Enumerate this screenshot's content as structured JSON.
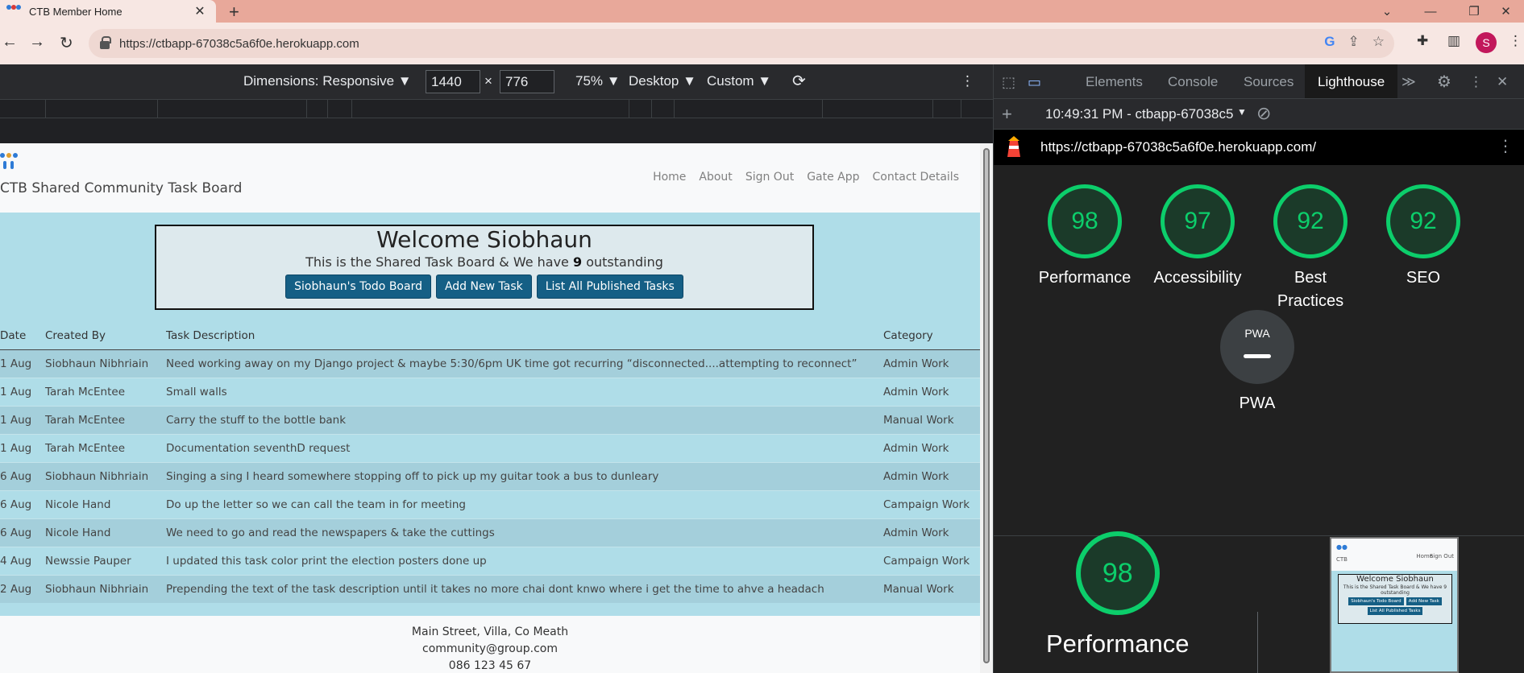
{
  "browser": {
    "tab_title": "CTB Member Home",
    "tab_close": "✕",
    "new_tab": "+",
    "url": "https://ctbapp-67038c5a6f0e.herokuapp.com",
    "profile_initial": "S",
    "win_minimize": "—",
    "win_restore": "❐",
    "win_close": "✕",
    "win_menu": "⌄"
  },
  "device_toolbar": {
    "dimensions_label": "Dimensions: Responsive ▼",
    "width": "1440",
    "times": "×",
    "height": "776",
    "zoom": "75% ▼",
    "device_type": "Desktop ▼",
    "throttle": "Custom ▼"
  },
  "site": {
    "brand": "CTB Shared Community Task Board",
    "nav": [
      "Home",
      "About",
      "Sign Out",
      "Gate App",
      "Contact Details"
    ],
    "welcome_title": "Welcome Siobhaun",
    "welcome_sub_before": "This is the Shared Task Board & We have ",
    "outstanding_count": "9",
    "welcome_sub_after": " outstanding",
    "buttons": [
      "Siobhaun's Todo Board",
      "Add New Task",
      "List All Published Tasks"
    ],
    "table": {
      "headers": [
        "Date",
        "Created By",
        "Task Description",
        "Category"
      ],
      "rows": [
        [
          "1 Aug",
          "Siobhaun Nibhriain",
          "Need working away on my Django project & maybe 5:30/6pm UK time got recurring “disconnected....attempting to reconnect”",
          "Admin Work"
        ],
        [
          "1 Aug",
          "Tarah McEntee",
          "Small walls",
          "Admin Work"
        ],
        [
          "1 Aug",
          "Tarah McEntee",
          "Carry the stuff to the bottle bank",
          "Manual Work"
        ],
        [
          "1 Aug",
          "Tarah McEntee",
          "Documentation seventhD request",
          "Admin Work"
        ],
        [
          "6 Aug",
          "Siobhaun Nibhriain",
          "Singing a sing I heard somewhere stopping off to pick up my guitar took a bus to dunleary",
          "Admin Work"
        ],
        [
          "6 Aug",
          "Nicole Hand",
          "Do up the letter so we can call the team in for meeting",
          "Campaign Work"
        ],
        [
          "6 Aug",
          "Nicole Hand",
          "We need to go and read the newspapers & take the cuttings",
          "Admin Work"
        ],
        [
          "4 Aug",
          "Newssie Pauper",
          "I updated this task color print the election posters done up",
          "Campaign Work"
        ],
        [
          "2 Aug",
          "Siobhaun Nibhriain",
          "Prepending the text of the task description until it takes no more chai dont knwo where i get the time to ahve a headach",
          "Manual Work"
        ]
      ]
    },
    "footer": [
      "Main Street, Villa, Co Meath",
      "community@group.com",
      "086 123 45 67"
    ]
  },
  "devtools": {
    "tabs": [
      "Elements",
      "Console",
      "Sources",
      "Lighthouse"
    ],
    "active_tab": "Lighthouse",
    "more_tabs": "≫",
    "report_time": "10:49:31 PM - ctbapp-67038c5",
    "report_url": "https://ctbapp-67038c5a6f0e.herokuapp.com/",
    "scores": [
      {
        "label": "Performance",
        "score": "98"
      },
      {
        "label": "Accessibility",
        "score": "97"
      },
      {
        "label": "Best Practices",
        "score": "92"
      },
      {
        "label": "SEO",
        "score": "92"
      }
    ],
    "pwa_label": "PWA",
    "pwa_badge": "PWA",
    "big_score": "98",
    "big_label": "Performance",
    "thumb": {
      "brand": "CTB",
      "nav": [
        "Home",
        "Sign Out"
      ],
      "title": "Welcome Siobhaun",
      "sub": "This is the Shared Task Board & We have 9 outstanding",
      "buttons": [
        "Siobhaun's Todo Board",
        "Add New Task",
        "List All Published Tasks"
      ]
    },
    "colors": {
      "pass": "#0cce6b",
      "pass_bg": "#1b3a29"
    }
  }
}
